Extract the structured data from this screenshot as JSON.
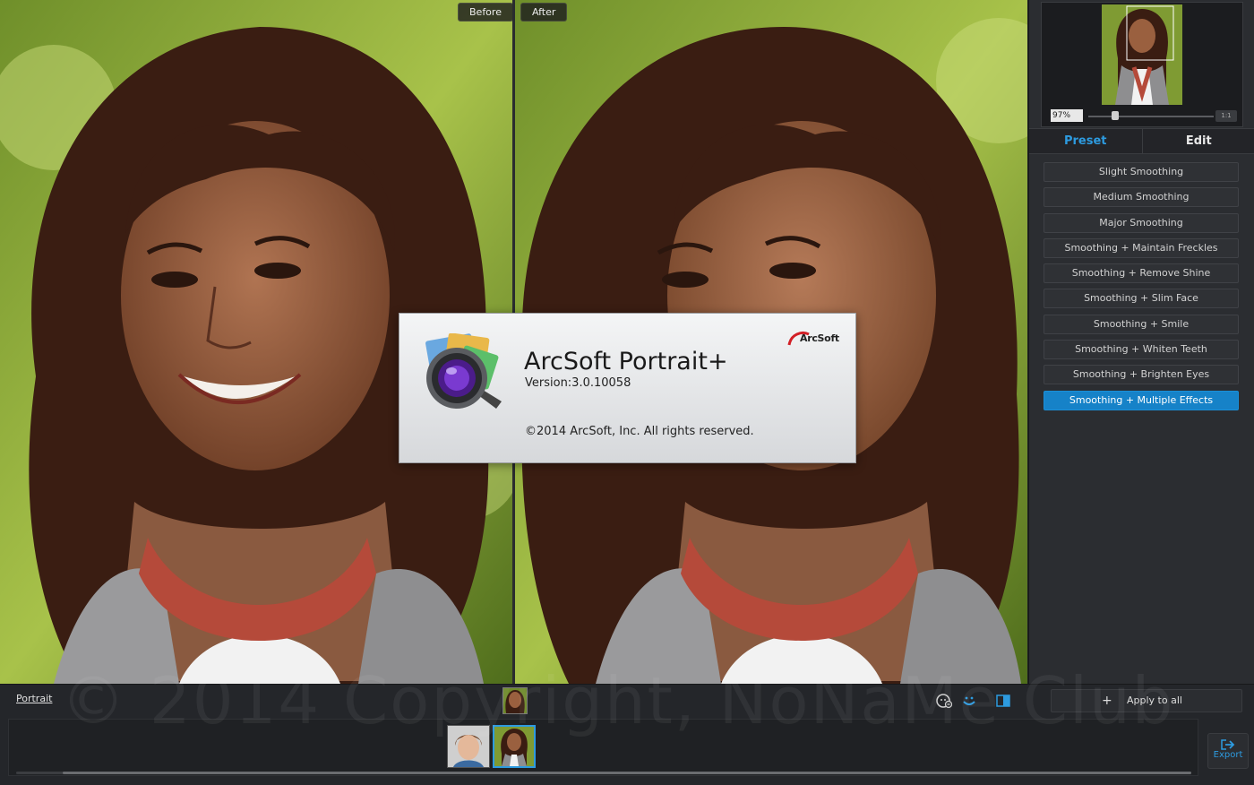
{
  "viewer": {
    "before_label": "Before",
    "after_label": "After"
  },
  "navigator": {
    "zoom_value": "97%",
    "zoom_level": 0.2,
    "fit_label": "1:1"
  },
  "tabs": {
    "preset": "Preset",
    "edit": "Edit"
  },
  "presets": [
    "Slight Smoothing",
    "Medium Smoothing",
    "Major Smoothing",
    "Smoothing + Maintain Freckles",
    "Smoothing + Remove Shine",
    "Smoothing + Slim Face",
    "Smoothing + Smile",
    "Smoothing + Whiten Teeth",
    "Smoothing + Brighten Eyes",
    "Smoothing + Multiple Effects"
  ],
  "active_preset_index": 9,
  "bottom": {
    "mode_label": "Portrait",
    "apply_all_label": "Apply to all",
    "export_label": "Export",
    "watermark": "© 2014 Copyright, NoNaMe Club"
  },
  "about": {
    "app_name": "ArcSoft Portrait+",
    "version": "Version:3.0.10058",
    "copyright": "©2014 ArcSoft, Inc. All rights reserved.",
    "brand": "ArcSoft"
  },
  "colors": {
    "accent": "#1682c8",
    "tab_active": "#2d9be0"
  }
}
